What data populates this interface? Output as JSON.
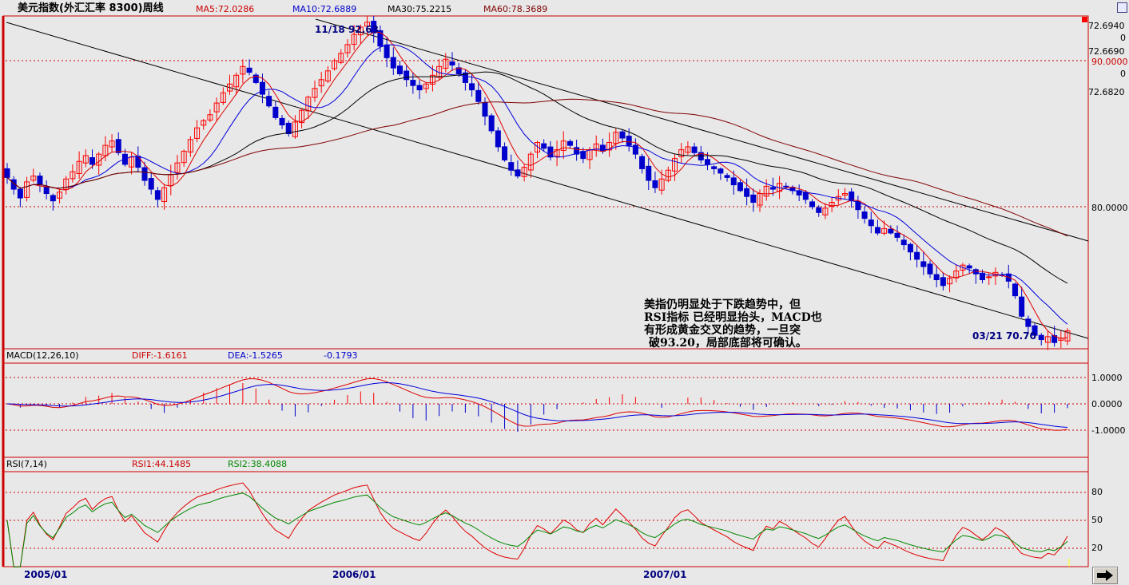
{
  "header": {
    "title": "美元指数(外汇汇率 8300)周线",
    "ma5": "MA5:72.0286",
    "ma10": "MA10:72.6889",
    "ma30": "MA30:75.2215",
    "ma60": "MA60:78.3689"
  },
  "macd_header": {
    "name": "MACD(12,26,10)",
    "diff": "DIFF:-1.6161",
    "dea": "DEA:-1.5265",
    "macd": "-0.1793"
  },
  "rsi_header": {
    "name": "RSI(7,14)",
    "rsi1": "RSI1:44.1485",
    "rsi2": "RSI2:38.4088"
  },
  "annotations": {
    "high": "11/18 92.63",
    "low": "03/21 70.70",
    "comment_lines": [
      "美指仍明显处于下跌趋势中，但",
      "RSI指标 已经明显抬头，MACD也",
      "有形成黄金交叉的趋势，一旦突",
      "破93.20，局部底部将可确认。"
    ]
  },
  "x_labels": [
    "2005/01",
    "2006/01",
    "2007/01"
  ],
  "price_axis": [
    "72.6940",
    "0",
    "72.6690",
    "90.0000",
    "0",
    "72.6820",
    "80.0000"
  ],
  "macd_axis": [
    "1.0000",
    "0.0000",
    "-1.0000"
  ],
  "rsi_axis": [
    "80",
    "50",
    "20"
  ],
  "colors": {
    "up": "#ff0000",
    "down": "#0000cc",
    "ma5": "#e00000",
    "ma10": "#0000dd",
    "ma30": "#000000",
    "ma60": "#800000",
    "frame": "#cc0000"
  },
  "icons": {
    "next": "arrow-right-icon",
    "close": "window-close-icon"
  },
  "chart_data": [
    {
      "type": "candlestick",
      "title": "美元指数(外汇汇率 8300)周线",
      "period": "weekly",
      "x_range": [
        "2004/12",
        "2008/03"
      ],
      "ylim": [
        70,
        95
      ],
      "gridlines": [
        90,
        80
      ],
      "high": {
        "date": "11/18",
        "value": 92.63
      },
      "low": {
        "date": "03/21",
        "value": 70.7
      },
      "series_close": [
        82.0,
        81.2,
        80.6,
        81.7,
        82.1,
        81.5,
        80.9,
        80.4,
        81.0,
        81.9,
        82.4,
        83.1,
        83.5,
        82.9,
        83.6,
        84.2,
        84.5,
        83.7,
        82.9,
        83.4,
        82.7,
        81.8,
        81.2,
        80.5,
        81.3,
        82.2,
        83.0,
        83.8,
        84.6,
        85.4,
        85.9,
        86.3,
        87.1,
        87.8,
        88.4,
        89.0,
        89.6,
        89.2,
        88.5,
        87.7,
        86.9,
        86.1,
        85.6,
        85.0,
        85.8,
        86.6,
        87.5,
        88.1,
        88.7,
        89.3,
        90.0,
        90.5,
        91.1,
        91.8,
        92.3,
        92.63,
        91.9,
        91.0,
        90.2,
        89.5,
        89.1,
        88.7,
        88.3,
        88.0,
        88.4,
        89.0,
        89.6,
        90.1,
        89.7,
        89.1,
        88.5,
        88.0,
        87.2,
        86.2,
        85.2,
        84.1,
        83.2,
        82.5,
        82.1,
        82.7,
        83.6,
        84.4,
        84.0,
        83.4,
        83.9,
        84.5,
        84.2,
        83.6,
        83.3,
        83.9,
        84.3,
        83.8,
        84.4,
        85.1,
        84.7,
        84.2,
        83.6,
        82.6,
        81.8,
        81.3,
        81.9,
        82.5,
        83.3,
        83.9,
        84.1,
        83.7,
        83.2,
        82.9,
        82.6,
        82.3,
        82.0,
        81.5,
        81.1,
        80.7,
        80.3,
        80.9,
        81.4,
        81.2,
        81.6,
        81.4,
        81.1,
        80.8,
        80.5,
        80.0,
        79.6,
        79.9,
        80.3,
        80.7,
        80.9,
        80.4,
        79.8,
        79.2,
        78.7,
        78.2,
        78.5,
        78.2,
        77.9,
        77.4,
        76.9,
        76.4,
        75.9,
        75.4,
        75.0,
        74.6,
        75.1,
        75.6,
        76.0,
        75.8,
        75.4,
        75.0,
        75.2,
        75.5,
        75.3,
        74.9,
        73.9,
        72.5,
        71.8,
        71.2,
        70.9,
        71.1,
        70.7,
        71.0,
        71.5
      ]
    },
    {
      "type": "line",
      "title": "MACD(12,26,10)",
      "series": [
        {
          "name": "DIFF",
          "last": -1.6161
        },
        {
          "name": "DEA",
          "last": -1.5265
        }
      ],
      "histogram_last": -0.1793,
      "ylim": [
        -1.8,
        1.5
      ],
      "gridlines": [
        1.0,
        0.0,
        -1.0
      ]
    },
    {
      "type": "line",
      "title": "RSI(7,14)",
      "series": [
        {
          "name": "RSI1",
          "last": 44.1485
        },
        {
          "name": "RSI2",
          "last": 38.4088
        }
      ],
      "ylim": [
        0,
        100
      ],
      "gridlines": [
        80,
        50,
        20
      ]
    }
  ]
}
